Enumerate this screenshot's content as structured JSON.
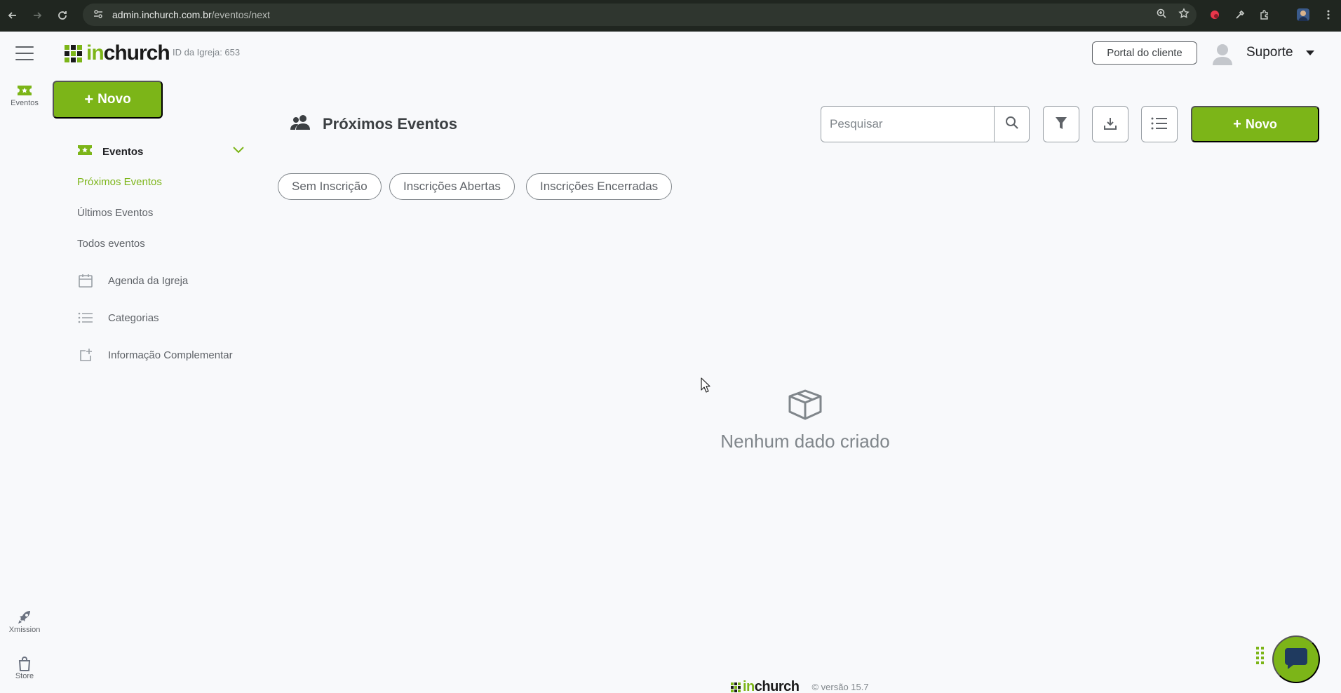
{
  "browser": {
    "url_domain": "admin.inchurch.com.br",
    "url_path": "/eventos/next"
  },
  "rail": {
    "items": [
      {
        "label": "Eventos"
      },
      {
        "label": "Xmission"
      },
      {
        "label": "Store"
      }
    ]
  },
  "header": {
    "logo_in": "in",
    "logo_rest": "church",
    "church_id": "ID da Igreja: 653",
    "portal_label": "Portal do cliente",
    "user_name": "Suporte"
  },
  "sidebar": {
    "new_label": "Novo",
    "section_label": "Eventos",
    "sub_items": [
      {
        "label": "Próximos Eventos",
        "active": true
      },
      {
        "label": "Últimos Eventos",
        "active": false
      },
      {
        "label": "Todos eventos",
        "active": false
      }
    ],
    "items": [
      {
        "label": "Agenda da Igreja",
        "icon": "calendar-icon"
      },
      {
        "label": "Categorias",
        "icon": "list-icon"
      },
      {
        "label": "Informação Complementar",
        "icon": "add-info-icon"
      }
    ]
  },
  "main": {
    "title": "Próximos Eventos",
    "search_placeholder": "Pesquisar",
    "new_label": "Novo",
    "chips": [
      "Sem Inscrição",
      "Inscrições Abertas",
      "Inscrições Encerradas"
    ],
    "empty_text": "Nenhum dado criado"
  },
  "footer": {
    "logo_in": "in",
    "logo_rest": "church",
    "version": "© versão 15.7"
  },
  "colors": {
    "brand": "#7cb518",
    "chrome": "#202620"
  }
}
